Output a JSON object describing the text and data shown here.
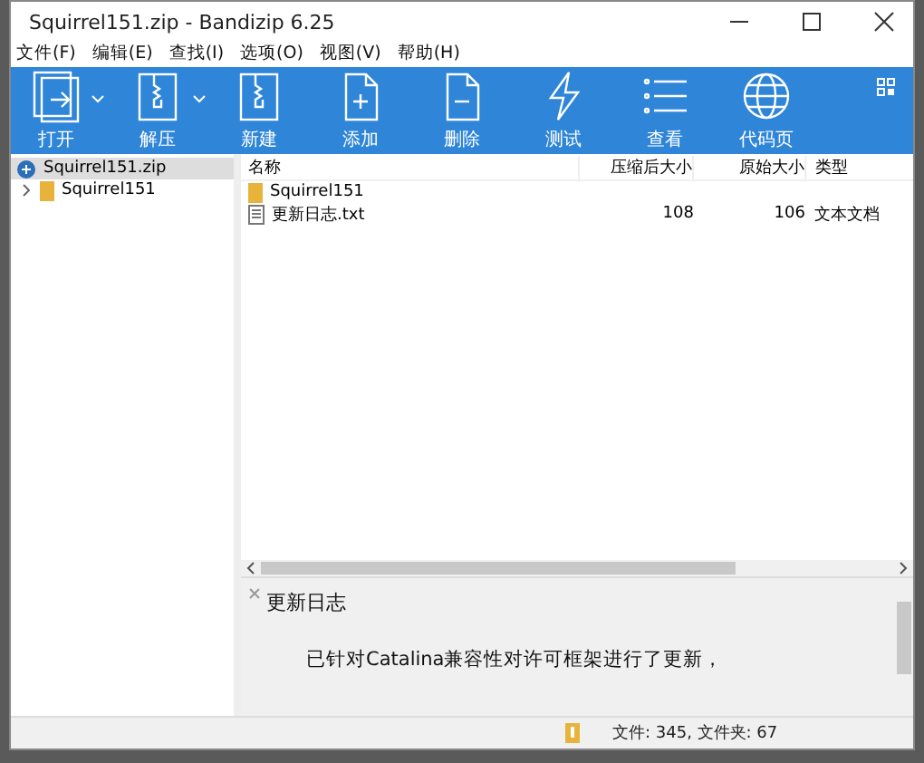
{
  "window": {
    "title": "Squirrel151.zip - Bandizip 6.25"
  },
  "menu": [
    "文件(F)",
    "编辑(E)",
    "查找(I)",
    "选项(O)",
    "视图(V)",
    "帮助(H)"
  ],
  "toolbar": [
    {
      "label": "打开",
      "kind": "open",
      "dropdown": true
    },
    {
      "label": "解压",
      "kind": "extract",
      "dropdown": true
    },
    {
      "label": "新建",
      "kind": "new",
      "dropdown": false
    },
    {
      "label": "添加",
      "kind": "add",
      "dropdown": false
    },
    {
      "label": "删除",
      "kind": "delete",
      "dropdown": false
    },
    {
      "label": "测试",
      "kind": "test",
      "dropdown": false
    },
    {
      "label": "查看",
      "kind": "view",
      "dropdown": false
    },
    {
      "label": "代码页",
      "kind": "codepage",
      "dropdown": false
    }
  ],
  "tree": {
    "label": "Squirrel151.zip",
    "selected": true,
    "children": [
      {
        "label": "Squirrel151",
        "selected": false,
        "expanded": false
      }
    ]
  },
  "table": {
    "columns": [
      "名称",
      "压缩后大小",
      "原始大小",
      "类型"
    ],
    "rows": [
      {
        "kind": "folder",
        "name": "Squirrel151",
        "packed": "",
        "size": "",
        "type": ""
      },
      {
        "kind": "file",
        "name": "更新日志.txt",
        "packed": "108",
        "size": "106",
        "type": "文本文档"
      }
    ]
  },
  "preview": {
    "title": "更新日志",
    "body": "已针对Catalina兼容性对许可框架进行了更新，"
  },
  "status_bar": "文件: 345, 文件夹: 67"
}
